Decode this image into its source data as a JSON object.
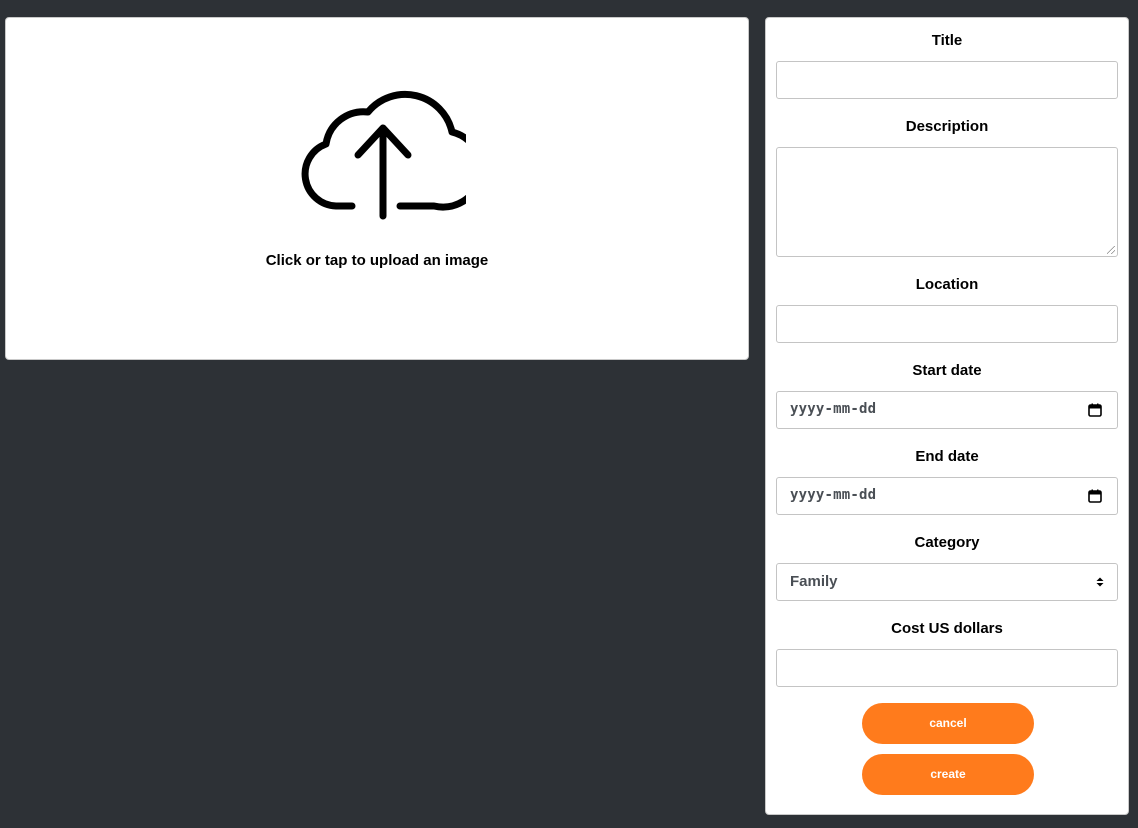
{
  "upload": {
    "icon": "cloud-upload-icon",
    "text": "Click or tap to upload an image"
  },
  "form": {
    "title_label": "Title",
    "title_value": "",
    "description_label": "Description",
    "description_value": "",
    "location_label": "Location",
    "location_value": "",
    "start_date_label": "Start date",
    "start_date_placeholder": "yyyy-mm-dd",
    "end_date_label": "End date",
    "end_date_placeholder": "yyyy-mm-dd",
    "category_label": "Category",
    "category_value": "Family",
    "cost_label": "Cost US dollars",
    "cost_value": "",
    "cancel_label": "cancel",
    "create_label": "create"
  },
  "colors": {
    "background": "#2d3136",
    "panel": "#ffffff",
    "accent": "#ff7b1c"
  }
}
